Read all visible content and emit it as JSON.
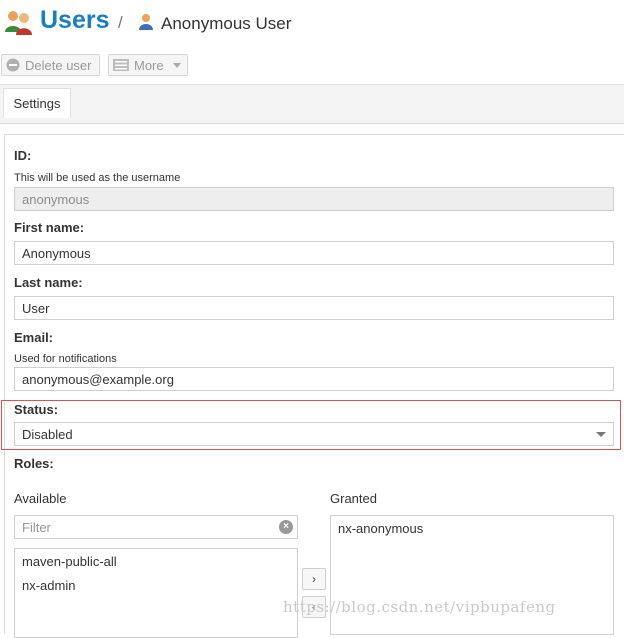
{
  "header": {
    "title": "Users",
    "separator": "/",
    "current_user": "Anonymous User"
  },
  "toolbar": {
    "delete_label": "Delete user",
    "more_label": "More"
  },
  "tabs": [
    {
      "label": "Settings",
      "active": true
    }
  ],
  "form": {
    "id": {
      "label": "ID:",
      "help": "This will be used as the username",
      "value": "anonymous"
    },
    "first_name": {
      "label": "First name:",
      "value": "Anonymous"
    },
    "last_name": {
      "label": "Last name:",
      "value": "User"
    },
    "email": {
      "label": "Email:",
      "help": "Used for notifications",
      "value": "anonymous@example.org"
    },
    "status": {
      "label": "Status:",
      "value": "Disabled"
    },
    "roles": {
      "label": "Roles:",
      "available_label": "Available",
      "granted_label": "Granted",
      "filter_placeholder": "Filter",
      "available": [
        "maven-public-all",
        "nx-admin"
      ],
      "granted": [
        "nx-anonymous"
      ],
      "move_right": "›",
      "move_left": "‹"
    }
  },
  "watermark": "https://blog.csdn.net/vipbupafeng",
  "colors": {
    "accent": "#1a7fc1",
    "highlight_border": "#d9534f"
  }
}
